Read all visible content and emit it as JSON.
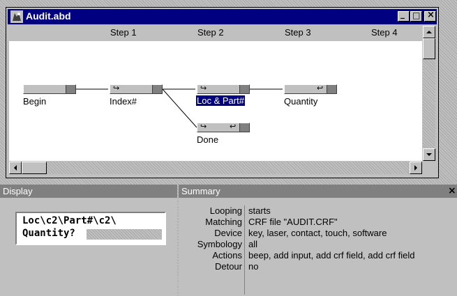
{
  "window": {
    "title": "Audit.abd",
    "minimize_glyph": "_",
    "maximize_glyph": "□",
    "close_glyph": "×"
  },
  "steps": [
    "Step 1",
    "Step 2",
    "Step 3",
    "Step 4"
  ],
  "nodes": {
    "begin": "Begin",
    "index": "Index#",
    "loc_part": "Loc & Part#",
    "quantity": "Quantity",
    "done": "Done"
  },
  "glyphs": {
    "forward": "↪",
    "back": "↩"
  },
  "colors": {
    "title_bar": "#000080",
    "selection": "#000080",
    "pane_title_bg": "#808080"
  },
  "display": {
    "title": "Display",
    "line1": "Loc\\c2\\Part#\\c2\\",
    "line2": "Quantity?"
  },
  "summary": {
    "title": "Summary",
    "close_glyph": "×",
    "rows": [
      {
        "key": "Looping",
        "value": "starts"
      },
      {
        "key": "Matching",
        "value": "CRF file \"AUDIT.CRF\""
      },
      {
        "key": "Device",
        "value": "key, laser, contact, touch, software"
      },
      {
        "key": "Symbology",
        "value": "all"
      },
      {
        "key": "Actions",
        "value": "beep, add input, add crf field, add crf field"
      },
      {
        "key": "Detour",
        "value": "no"
      }
    ]
  }
}
